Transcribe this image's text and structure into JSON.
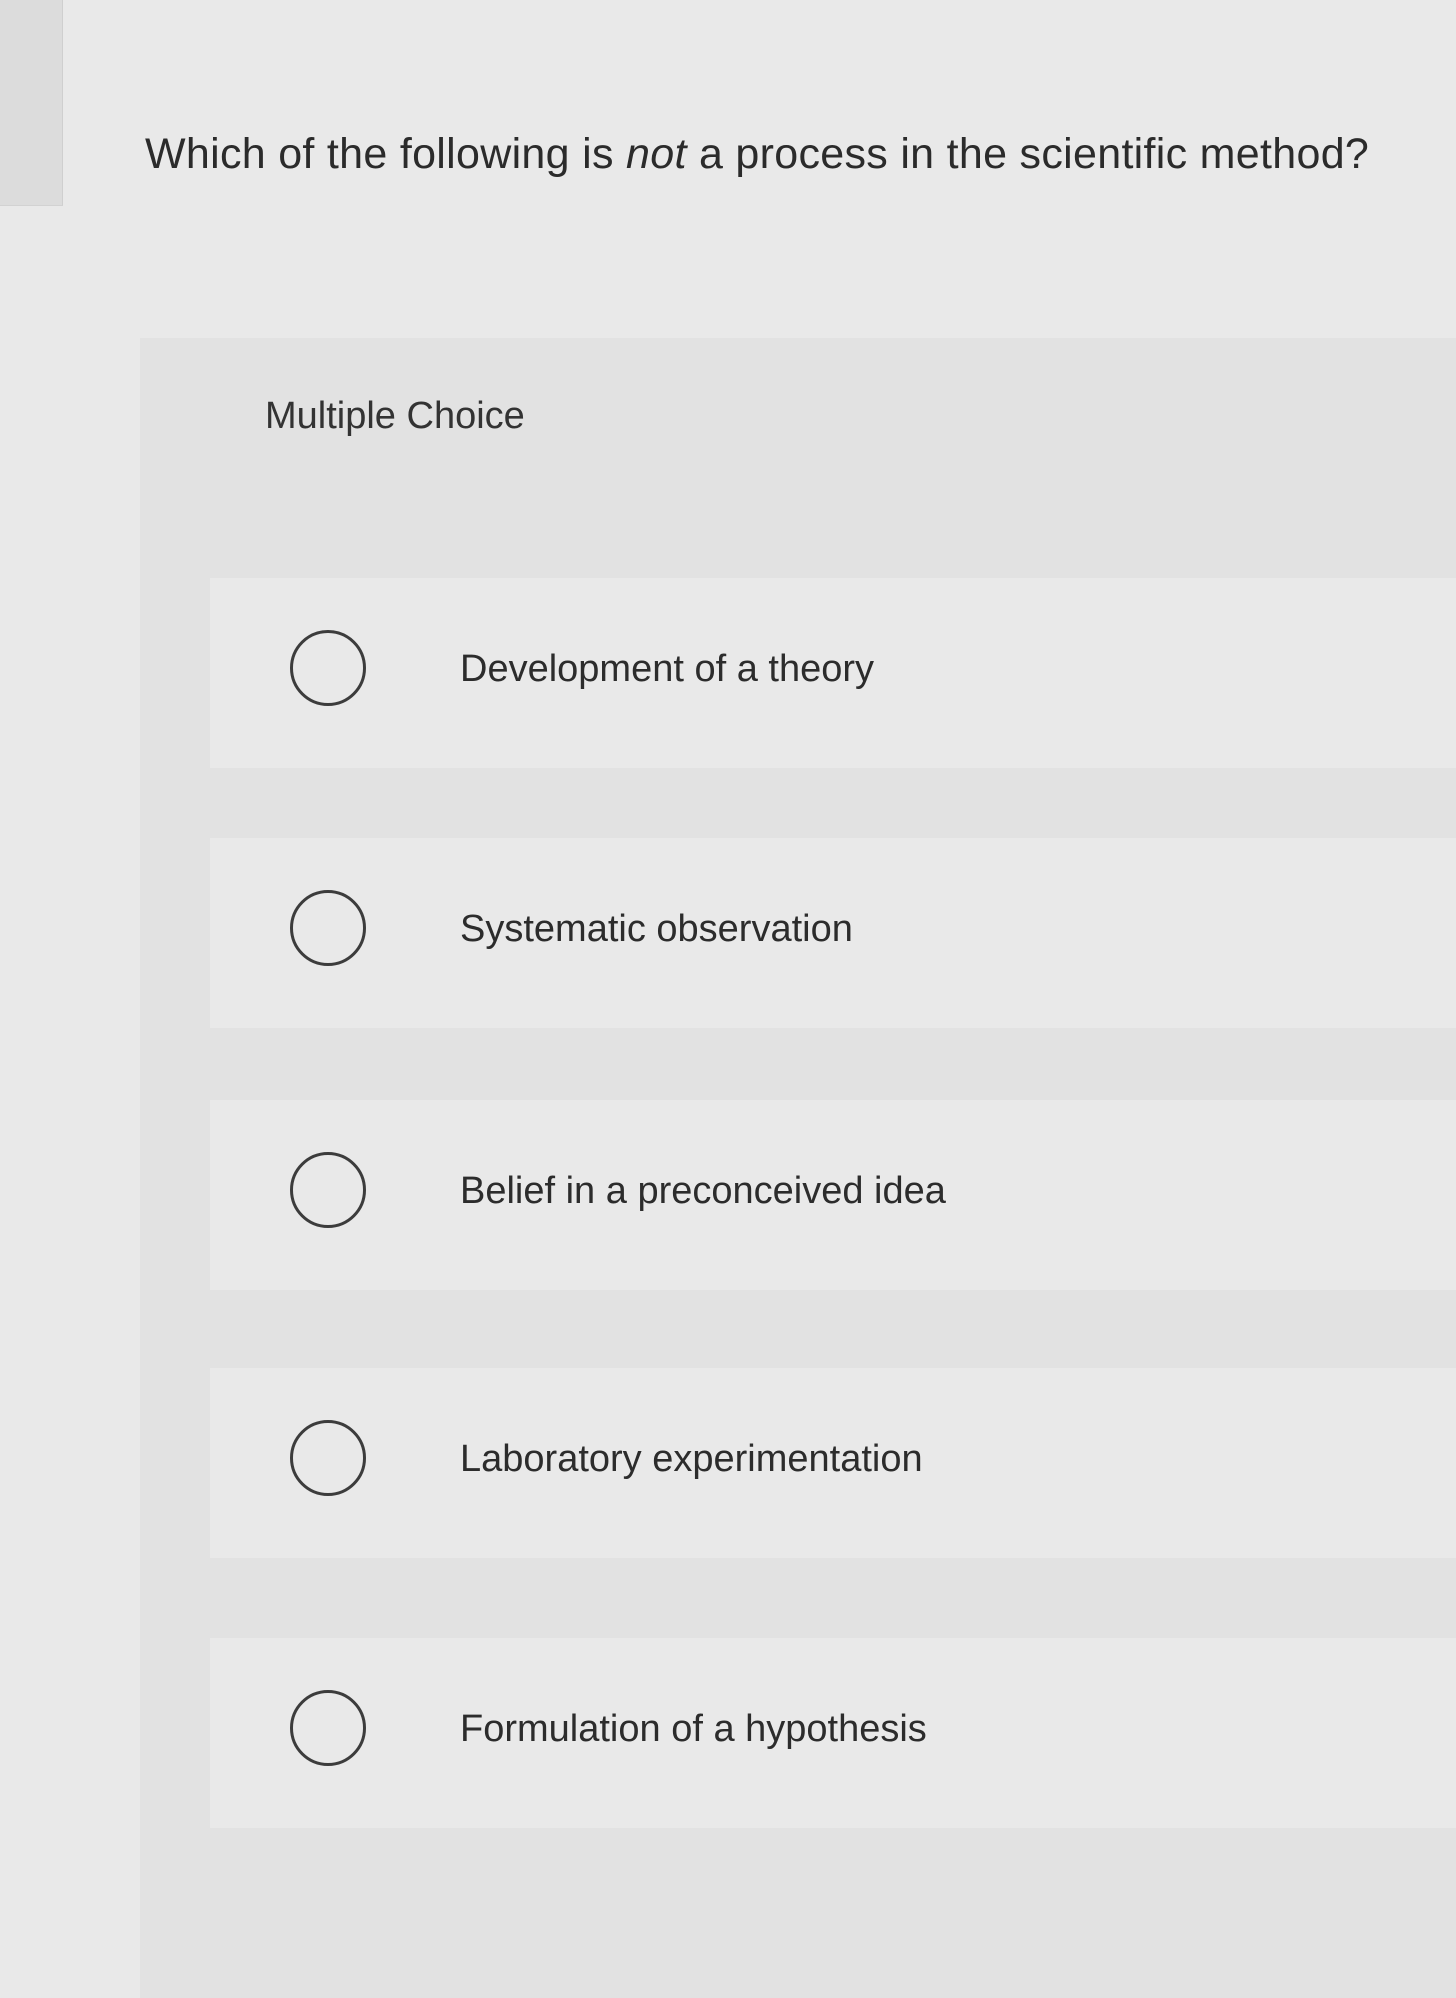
{
  "question": {
    "before": "Which of the following is ",
    "emphasis": "not",
    "after": " a process in the scientific method?"
  },
  "panel": {
    "label": "Multiple Choice"
  },
  "options": [
    {
      "label": "Development of a theory"
    },
    {
      "label": "Systematic observation"
    },
    {
      "label": "Belief in a preconceived idea"
    },
    {
      "label": "Laboratory experimentation"
    },
    {
      "label": "Formulation of a hypothesis"
    }
  ]
}
